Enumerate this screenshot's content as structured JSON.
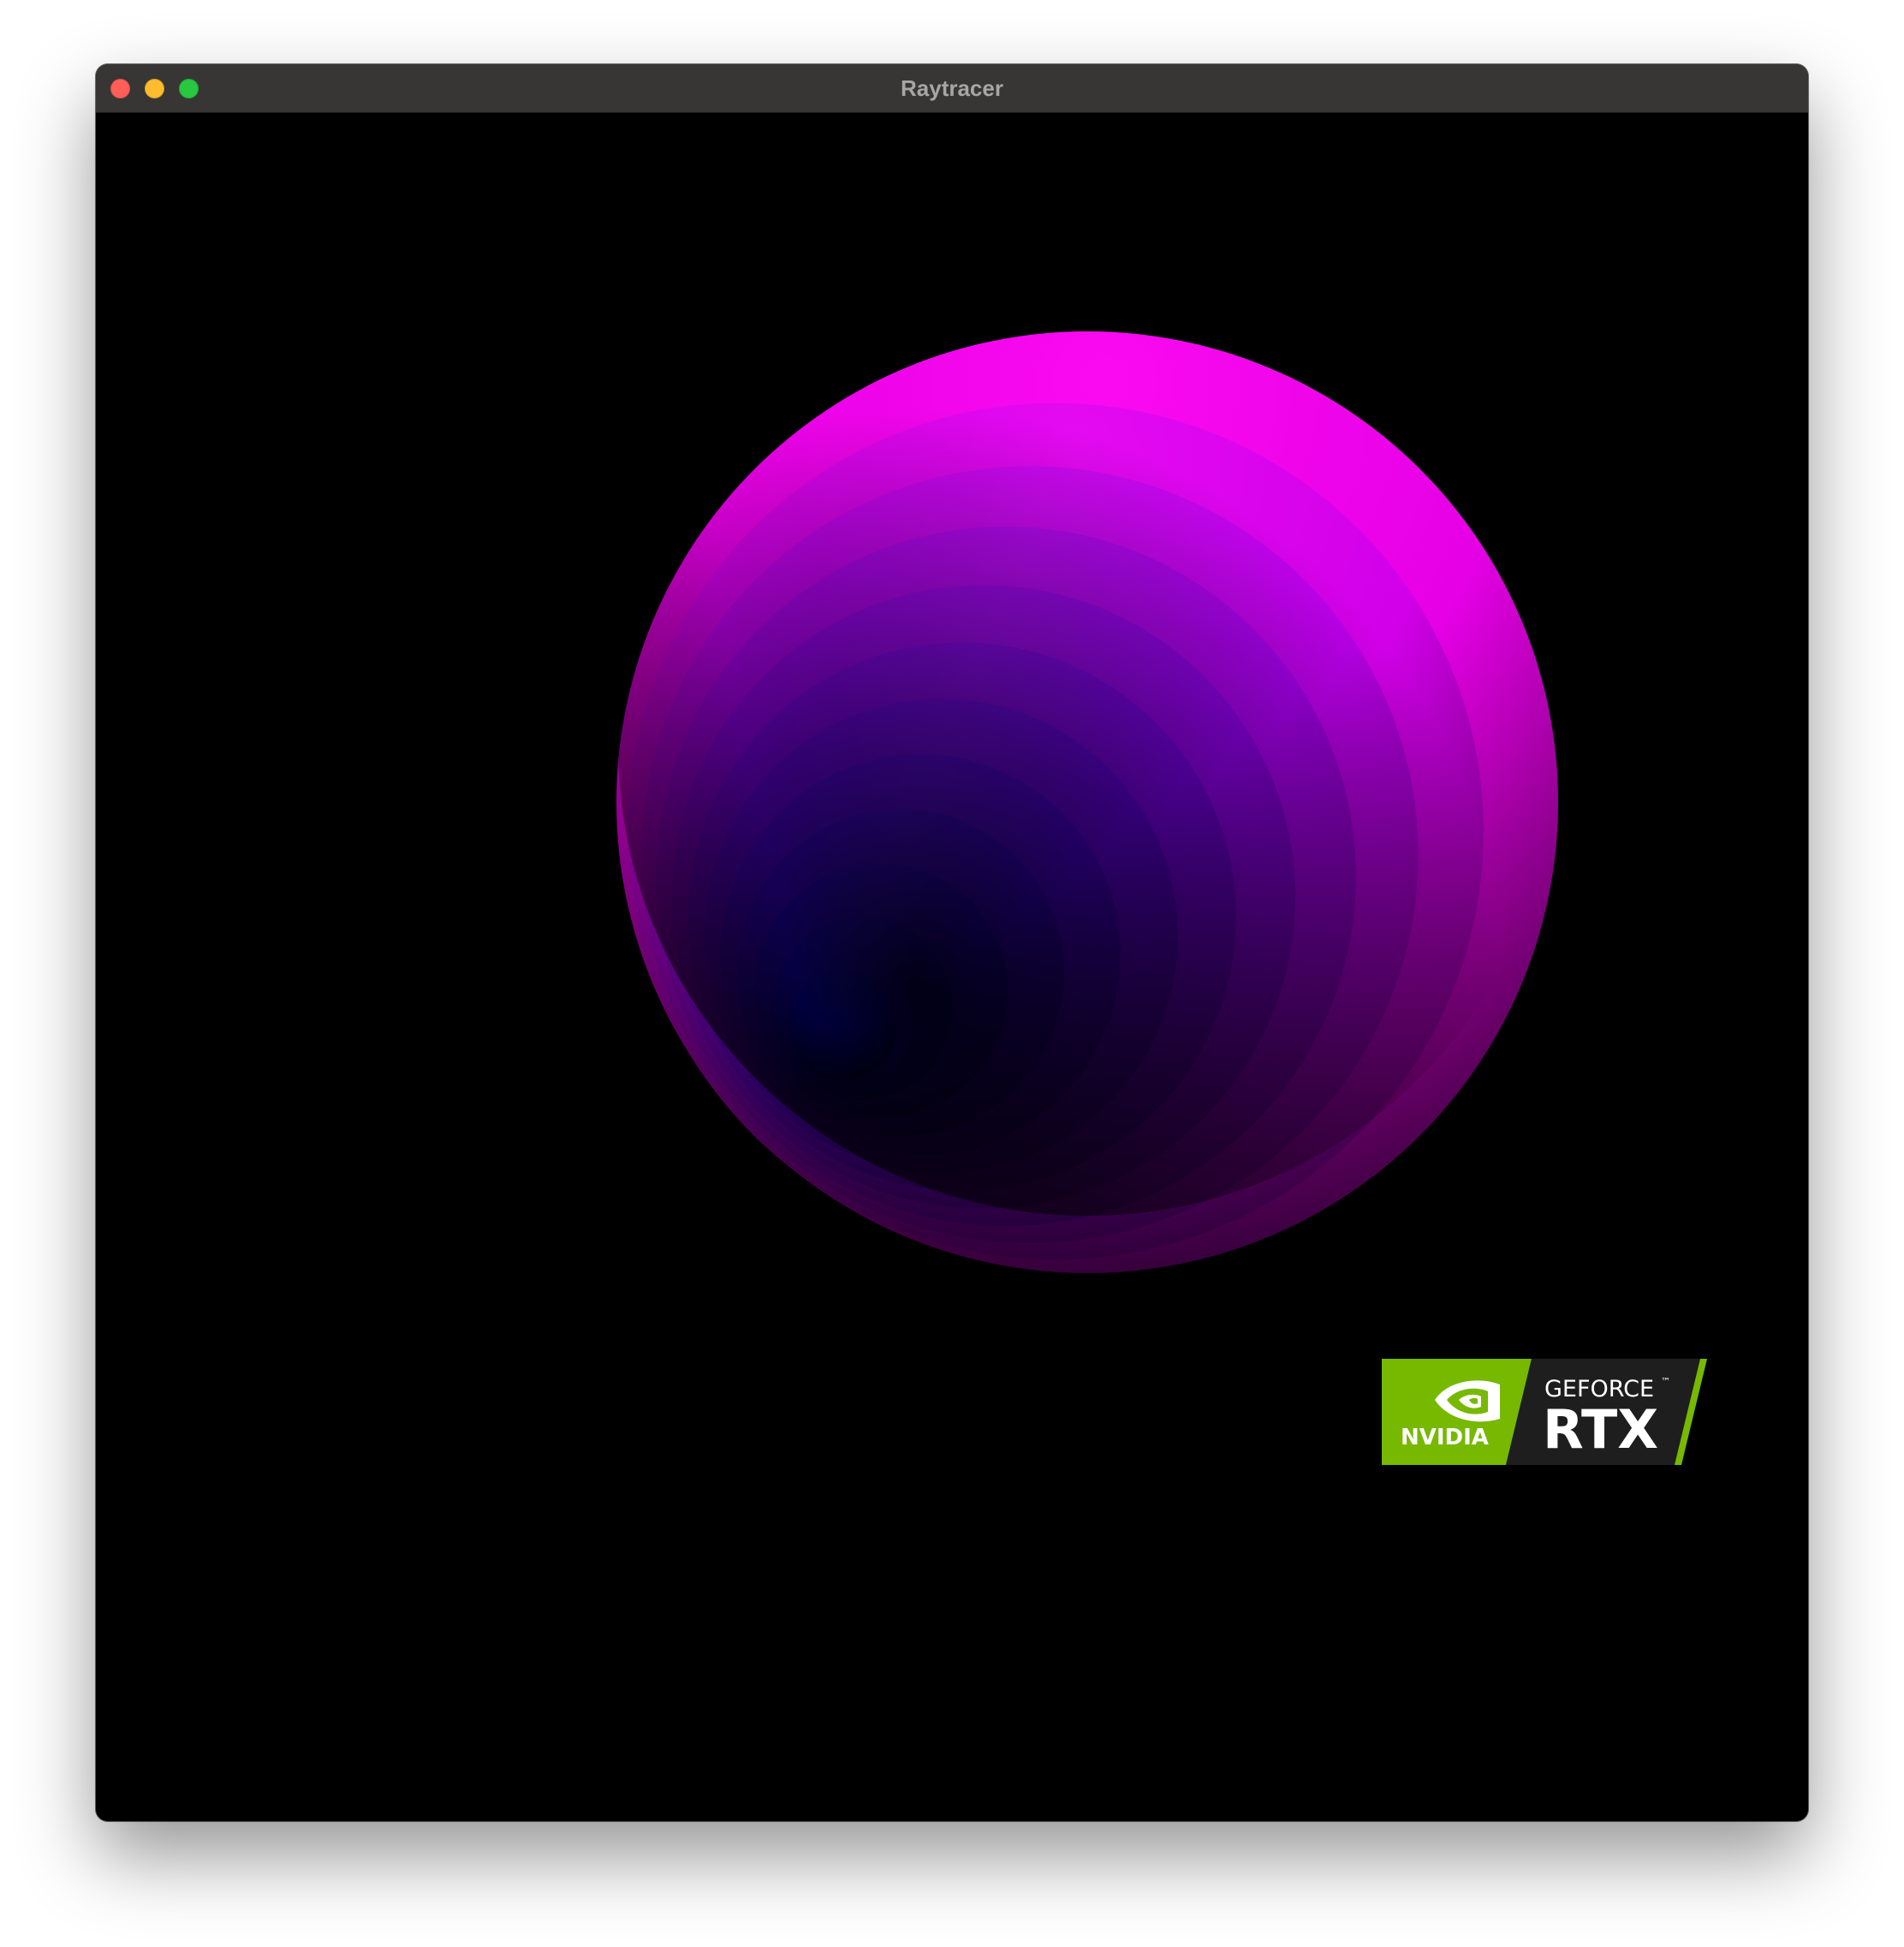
{
  "window": {
    "title": "Raytracer",
    "controls": {
      "close": "close-icon",
      "minimize": "minimize-icon",
      "zoom": "zoom-icon"
    }
  },
  "render": {
    "description_colors": {
      "outer": "#e600e6",
      "inner": "#0000ff",
      "shadow": "#000000"
    },
    "ring_count": 12
  },
  "badge": {
    "brand": "NVIDIA",
    "product_line": "GEFORCE",
    "trademark": "™",
    "product": "RTX",
    "colors": {
      "green": "#76b900",
      "dark": "#1e1e1e"
    }
  }
}
